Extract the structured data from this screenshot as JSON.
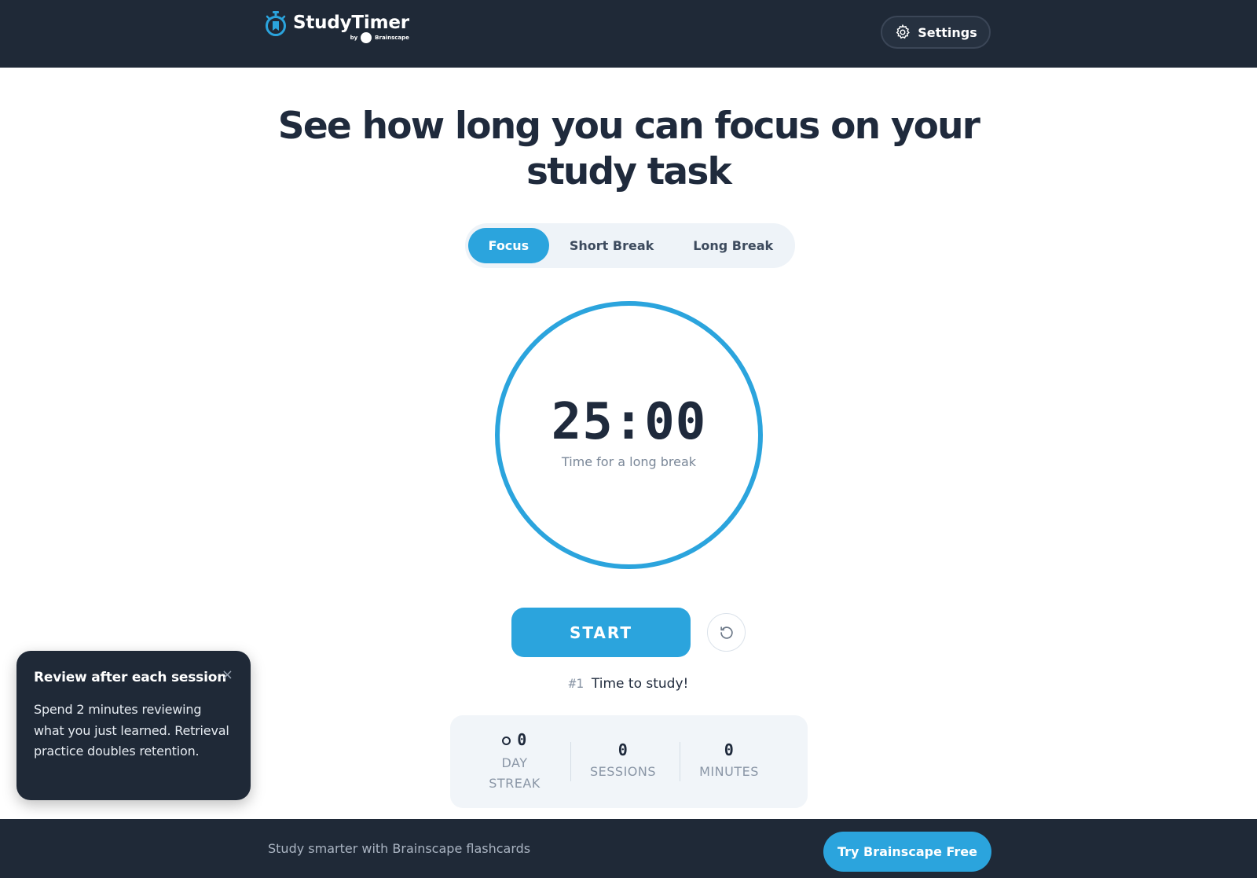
{
  "header": {
    "logo_title": "StudyTimer",
    "logo_by": "by",
    "logo_brand": "Brainscape",
    "settings_label": "Settings"
  },
  "headline": "See how long you can focus on your study task",
  "tabs": [
    {
      "label": "Focus",
      "active": true
    },
    {
      "label": "Short Break",
      "active": false
    },
    {
      "label": "Long Break",
      "active": false
    }
  ],
  "timer": {
    "time": "25:00",
    "label": "Time for a long break"
  },
  "controls": {
    "start_label": "START",
    "reset_icon": "reset-icon"
  },
  "session": {
    "number": "#1",
    "message": "Time to study!"
  },
  "stats": {
    "streak_value": "0",
    "streak_label_1": "DAY",
    "streak_label_2": "STREAK",
    "sessions_value": "0",
    "sessions_label": "SESSIONS",
    "minutes_value": "0",
    "minutes_label": "MINUTES"
  },
  "toast": {
    "title": "Review after each session",
    "close": "×",
    "body": "Spend 2 minutes reviewing what you just learned. Retrieval practice doubles retention."
  },
  "footer": {
    "text": "Study smarter with Brainscape flashcards",
    "cta_label": "Try Brainscape Free"
  },
  "colors": {
    "accent": "#2ba4dd",
    "dark": "#1f2937",
    "text": "#1f2a3c"
  }
}
